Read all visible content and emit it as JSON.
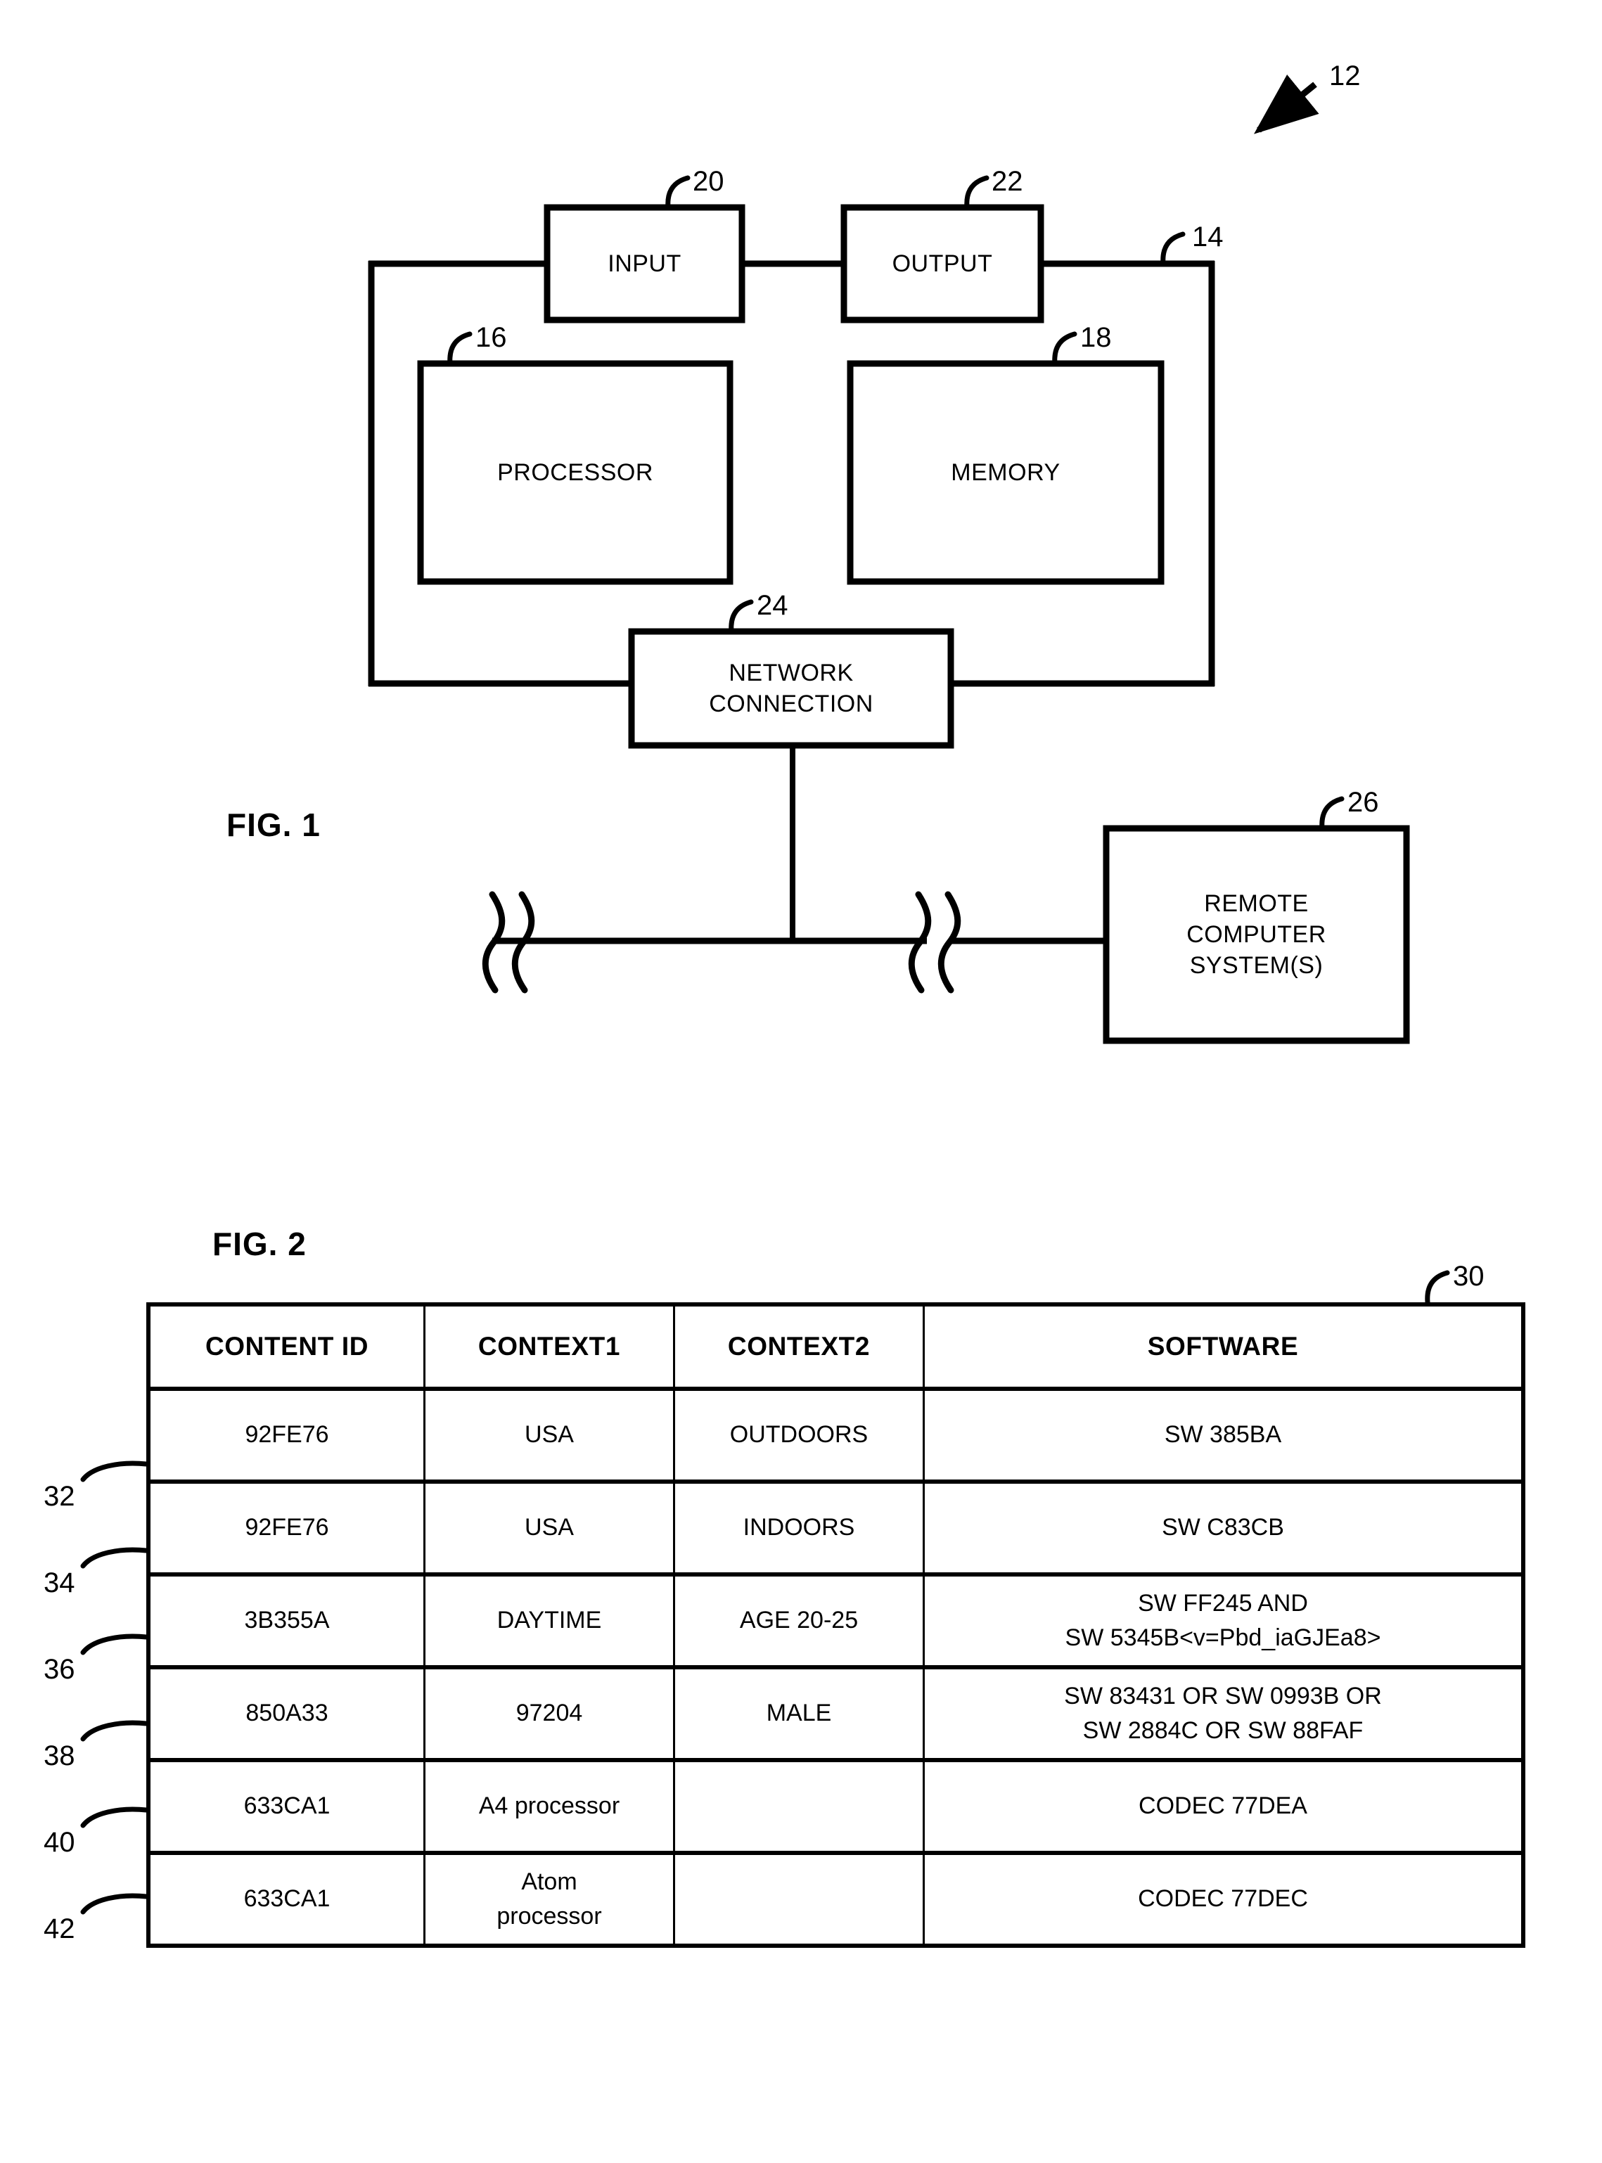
{
  "figure1": {
    "caption": "FIG. 1",
    "system_ref": "12",
    "computer_frame_ref": "14",
    "blocks": [
      {
        "id": "input",
        "label": "INPUT",
        "ref": "20"
      },
      {
        "id": "output",
        "label": "OUTPUT",
        "ref": "22"
      },
      {
        "id": "processor",
        "label": "PROCESSOR",
        "ref": "16"
      },
      {
        "id": "memory",
        "label": "MEMORY",
        "ref": "18"
      },
      {
        "id": "network",
        "label": "NETWORK\nCONNECTION",
        "ref": "24"
      },
      {
        "id": "remote",
        "label": "REMOTE\nCOMPUTER\nSYSTEM(S)",
        "ref": "26"
      }
    ]
  },
  "figure2": {
    "caption": "FIG. 2",
    "table_ref": "30",
    "row_refs": [
      "32",
      "34",
      "36",
      "38",
      "40",
      "42"
    ],
    "columns": [
      "CONTENT ID",
      "CONTEXT1",
      "CONTEXT2",
      "SOFTWARE"
    ],
    "rows": [
      {
        "content_id": "92FE76",
        "context1": "USA",
        "context2": "OUTDOORS",
        "software": "SW 385BA"
      },
      {
        "content_id": "92FE76",
        "context1": "USA",
        "context2": "INDOORS",
        "software": "SW C83CB"
      },
      {
        "content_id": "3B355A",
        "context1": "DAYTIME",
        "context2": "AGE 20-25",
        "software": "SW FF245 AND\nSW 5345B<v=Pbd_iaGJEa8>"
      },
      {
        "content_id": "850A33",
        "context1": "97204",
        "context2": "MALE",
        "software": "SW 83431 OR SW 0993B OR\nSW 2884C OR SW 88FAF"
      },
      {
        "content_id": "633CA1",
        "context1": "A4 processor",
        "context2": "",
        "software": "CODEC 77DEA"
      },
      {
        "content_id": "633CA1",
        "context1": "Atom\nprocessor",
        "context2": "",
        "software": "CODEC 77DEC"
      }
    ]
  },
  "colors": {
    "ink": "#000000",
    "paper": "#ffffff"
  }
}
